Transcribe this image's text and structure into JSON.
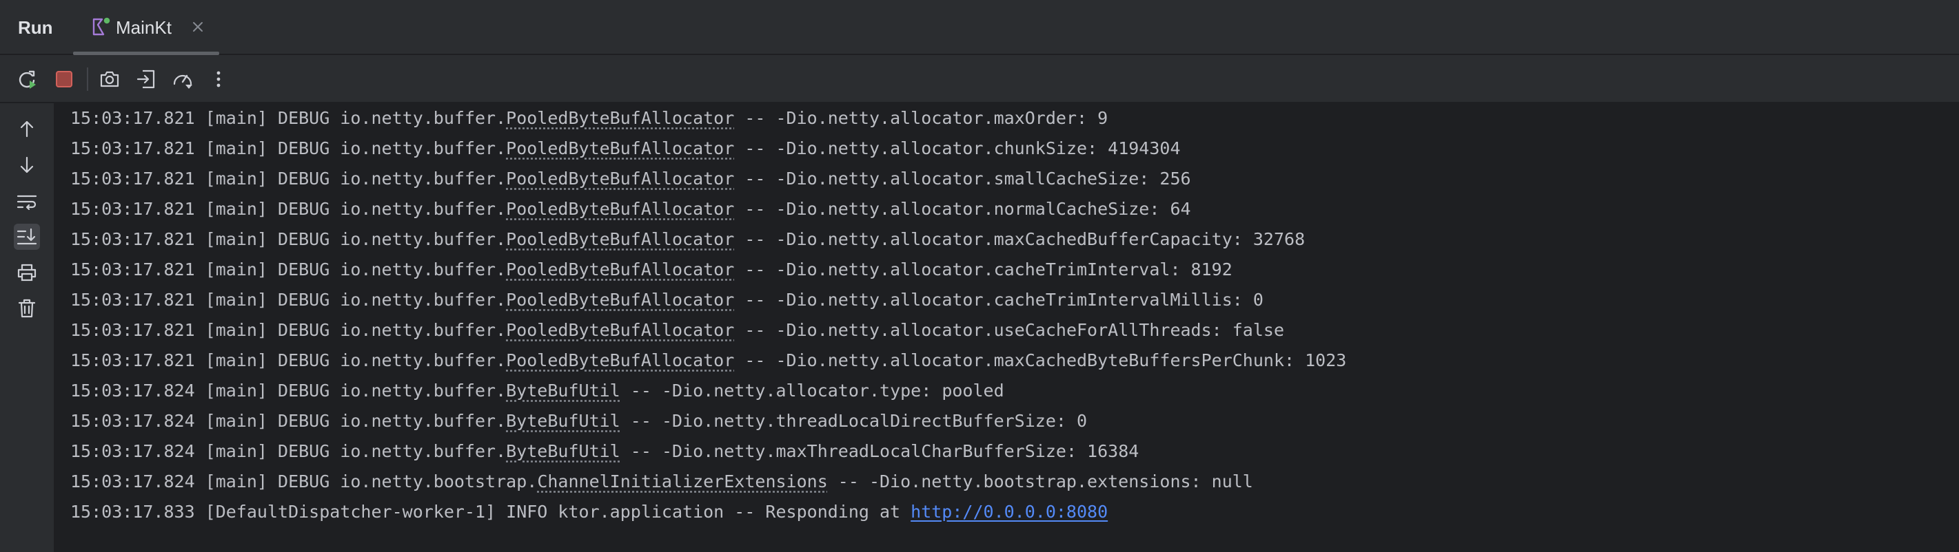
{
  "run": {
    "title": "Run",
    "tab_label": "MainKt",
    "tab_icon": "kotlin-run-config-icon",
    "close_icon": "close-icon"
  },
  "toolbar": {
    "buttons": [
      {
        "icon": "rerun-icon"
      },
      {
        "icon": "stop-icon",
        "color": "#c75450"
      },
      {
        "icon": "camera-icon"
      },
      {
        "icon": "export-icon"
      },
      {
        "icon": "profiler-icon"
      },
      {
        "icon": "more-vertical-icon"
      }
    ]
  },
  "gutter": {
    "buttons": [
      {
        "icon": "arrow-up-icon"
      },
      {
        "icon": "arrow-down-icon"
      },
      {
        "icon": "soft-wrap-icon"
      },
      {
        "icon": "scroll-to-end-icon",
        "active": true
      },
      {
        "icon": "print-icon"
      },
      {
        "icon": "trash-icon"
      }
    ]
  },
  "colors": {
    "background": "#1e1f22",
    "panel": "#2b2d30",
    "text": "#bcbec4",
    "link": "#548af7",
    "stop": "#c75450"
  },
  "log": {
    "lines": [
      {
        "prefix": "15:03:17.821 [main] DEBUG io.netty.buffer.",
        "cls": "PooledByteBufAllocator",
        "suffix": " -- -Dio.netty.allocator.maxOrder: 9"
      },
      {
        "prefix": "15:03:17.821 [main] DEBUG io.netty.buffer.",
        "cls": "PooledByteBufAllocator",
        "suffix": " -- -Dio.netty.allocator.chunkSize: 4194304"
      },
      {
        "prefix": "15:03:17.821 [main] DEBUG io.netty.buffer.",
        "cls": "PooledByteBufAllocator",
        "suffix": " -- -Dio.netty.allocator.smallCacheSize: 256"
      },
      {
        "prefix": "15:03:17.821 [main] DEBUG io.netty.buffer.",
        "cls": "PooledByteBufAllocator",
        "suffix": " -- -Dio.netty.allocator.normalCacheSize: 64"
      },
      {
        "prefix": "15:03:17.821 [main] DEBUG io.netty.buffer.",
        "cls": "PooledByteBufAllocator",
        "suffix": " -- -Dio.netty.allocator.maxCachedBufferCapacity: 32768"
      },
      {
        "prefix": "15:03:17.821 [main] DEBUG io.netty.buffer.",
        "cls": "PooledByteBufAllocator",
        "suffix": " -- -Dio.netty.allocator.cacheTrimInterval: 8192"
      },
      {
        "prefix": "15:03:17.821 [main] DEBUG io.netty.buffer.",
        "cls": "PooledByteBufAllocator",
        "suffix": " -- -Dio.netty.allocator.cacheTrimIntervalMillis: 0"
      },
      {
        "prefix": "15:03:17.821 [main] DEBUG io.netty.buffer.",
        "cls": "PooledByteBufAllocator",
        "suffix": " -- -Dio.netty.allocator.useCacheForAllThreads: false"
      },
      {
        "prefix": "15:03:17.821 [main] DEBUG io.netty.buffer.",
        "cls": "PooledByteBufAllocator",
        "suffix": " -- -Dio.netty.allocator.maxCachedByteBuffersPerChunk: 1023"
      },
      {
        "prefix": "15:03:17.824 [main] DEBUG io.netty.buffer.",
        "cls": "ByteBufUtil",
        "suffix": " -- -Dio.netty.allocator.type: pooled"
      },
      {
        "prefix": "15:03:17.824 [main] DEBUG io.netty.buffer.",
        "cls": "ByteBufUtil",
        "suffix": " -- -Dio.netty.threadLocalDirectBufferSize: 0"
      },
      {
        "prefix": "15:03:17.824 [main] DEBUG io.netty.buffer.",
        "cls": "ByteBufUtil",
        "suffix": " -- -Dio.netty.maxThreadLocalCharBufferSize: 16384"
      },
      {
        "prefix": "15:03:17.824 [main] DEBUG io.netty.bootstrap.",
        "cls": "ChannelInitializerExtensions",
        "suffix": " -- -Dio.netty.bootstrap.extensions: null"
      },
      {
        "prefix": "15:03:17.833 [DefaultDispatcher-worker-1] INFO ktor.application -- Responding at ",
        "link": "http://0.0.0.0:8080"
      }
    ]
  }
}
